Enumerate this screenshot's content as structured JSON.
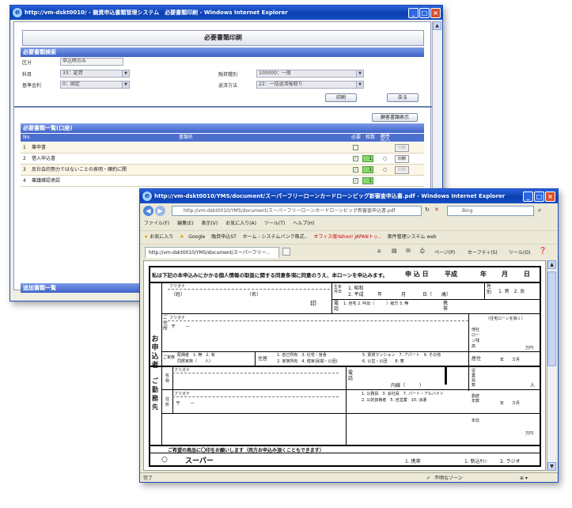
{
  "window1": {
    "title": "http://vm-dskt0010/ - 融資申込書類管理システム　必要書類印刷 - Windows Internet Explorer",
    "page_title": "必要書類印刷",
    "search_section": "必要書類検索",
    "labels": {
      "kubun": "区分",
      "kamoku": "科目",
      "kijun": "基準金利",
      "yuushi": "融資種別",
      "hensai": "返済方法"
    },
    "values": {
      "kubun": "申込時のみ",
      "kamoku": "33：証貸",
      "kijun": "0：固定",
      "yuushi": "100000：一般",
      "hensai": "22：一括返済後取り"
    },
    "print_button": "印刷",
    "back_button": "戻る",
    "customer_button": "顧客書類表示",
    "list_section": "必要書類一覧(口座)",
    "columns": [
      "No.",
      "書類名",
      "必要",
      "枚数",
      "顧客記入"
    ],
    "rows": [
      {
        "no": "1",
        "name": "稟申書",
        "count": ""
      },
      {
        "no": "2",
        "name": "借入申込書",
        "count": "1"
      },
      {
        "no": "3",
        "name": "反社会的勢力ではないことの表明・確約に関",
        "count": "1"
      },
      {
        "no": "4",
        "name": "稟議確認承認",
        "count": "1"
      }
    ],
    "row_print": "印刷",
    "extra_section": "追加書類一覧"
  },
  "window2": {
    "title": "http://vm-dskt0010/YMS/document/スーパーフリーローンカードローンビッグ新審査申込書.pdf - Windows Internet Explorer",
    "address": "http://vm-dskt0010/YMS/document/スーパーフリーローンカードローンビッグ新審査申込書.pdf",
    "search_placeholder": "Bing",
    "menu": [
      "ファイル(F)",
      "編集(E)",
      "表示(V)",
      "お気に入り(A)",
      "ツール(T)",
      "ヘルプ(H)"
    ],
    "favorites": [
      "お気に入り",
      "Google",
      "融資申込ST",
      "ホーム - システムバンク株式..",
      "オフィス版Yahoo! JAPANトッ..",
      "案件管理システム web"
    ],
    "tab": "http://vm-dskt0010/YMS/document/スーパーフリー..",
    "cmd": [
      "ページ(P)",
      "セーフティ(S)",
      "ツール(O)"
    ],
    "status_left": "完了",
    "status_zone": "不明なゾーン"
  },
  "form": {
    "header": "私は下記の本申込みにかかる個人情報の取扱に関する同意条項に同意のうえ、本ローンを申込みます。",
    "apply_date": "申 込 日",
    "era": "平成",
    "year": "年",
    "month": "月",
    "day": "日",
    "furigana": "フリガナ",
    "sei": "（姓）",
    "mei": "（名）",
    "seal": "印",
    "birth": "生年月日",
    "showa": "1. 昭和",
    "heisei": "2. 平成",
    "nen": "年",
    "gatsu": "月",
    "nichi_sai": "日（　　歳）",
    "sex": "性別",
    "sex_opt": "1. 男　2. 女",
    "tel": "電話",
    "tel_opts": "1. 自宅 2. 呼出（　　　）様方 3. 無",
    "mobile": "携帯",
    "applicant_vertical": "お申込者",
    "address": "ご住所",
    "zip": "〒　　－",
    "other_loan": "他社ローン残高",
    "other_loan_note": "（住宅ローンを除く）",
    "man_yen": "万円",
    "family": "ご家族",
    "spouse": "配偶者　1. 無　2. 有",
    "cohabit": "同居家族（　　人）",
    "residence": "住居",
    "res1": "1. 自己所有　3. 社宅・官舎",
    "res2": "2. 家族所有　4. 借家(民間・公団)",
    "res3": "5. 賃貸マンション　7. アパート　9. その他",
    "res4": "6. 公営・公団　　8. 寮",
    "years_living": "居住",
    "nen_kagetsu": "年　　カ月",
    "employer_vertical": "ご勤務先",
    "name_lbl": "名称",
    "addr_lbl": "住所",
    "naisen": "内線（　　　）",
    "employees": "従業員数",
    "nin": "人",
    "work_type": "1. 公務員　3. 会社員　7. パート・アルバイト",
    "work_type2": "2. 公的資格者　5. 自営業　10. 派遣",
    "service_years": "勤続年数",
    "income": "年収",
    "wishes": "ご希望の商品に〇印をお願いします（両方お申込み頂くこともできます）",
    "super": "スーパー",
    "bill_mobile": "1. 携帯",
    "radio": "2. ラジオ",
    "bank": "1. 新込ｻｲﾝ"
  }
}
